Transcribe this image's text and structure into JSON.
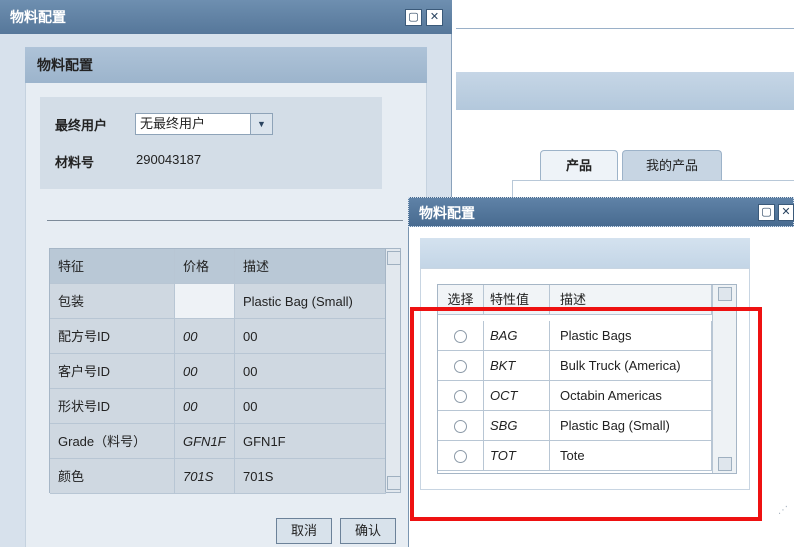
{
  "background": {
    "tabs": [
      {
        "label": "产品"
      },
      {
        "label": "我的产品"
      }
    ]
  },
  "main_dialog": {
    "title": "物料配置",
    "header": "物料配置",
    "end_user_label": "最终用户",
    "end_user_value": "无最终用户",
    "material_label": "材料号",
    "material_value": "290043187",
    "table": {
      "headers": {
        "feature": "特征",
        "price": "价格",
        "desc": "描述"
      },
      "rows": [
        {
          "feature": "包装",
          "price": "",
          "desc": "Plastic Bag (Small)"
        },
        {
          "feature": "配方号ID",
          "price": "00",
          "desc": "00"
        },
        {
          "feature": "客户号ID",
          "price": "00",
          "desc": "00"
        },
        {
          "feature": "形状号ID",
          "price": "00",
          "desc": "00"
        },
        {
          "feature": "Grade（料号）",
          "price": "GFN1F",
          "desc": "GFN1F"
        },
        {
          "feature": "颜色",
          "price": "701S",
          "desc": "701S"
        }
      ]
    },
    "buttons": {
      "cancel": "取消",
      "ok": "确认"
    }
  },
  "popup_dialog": {
    "title": "物料配置",
    "table": {
      "headers": {
        "select": "选择",
        "value": "特性值",
        "desc": "描述"
      },
      "rows": [
        {
          "value": "BAG",
          "desc": "Plastic Bags"
        },
        {
          "value": "BKT",
          "desc": "Bulk Truck (America)"
        },
        {
          "value": "OCT",
          "desc": "Octabin Americas"
        },
        {
          "value": "SBG",
          "desc": "Plastic Bag (Small)"
        },
        {
          "value": "TOT",
          "desc": "Tote"
        }
      ]
    }
  },
  "colors": {
    "highlight": "#ee1111",
    "title_bar": "#56779a"
  }
}
